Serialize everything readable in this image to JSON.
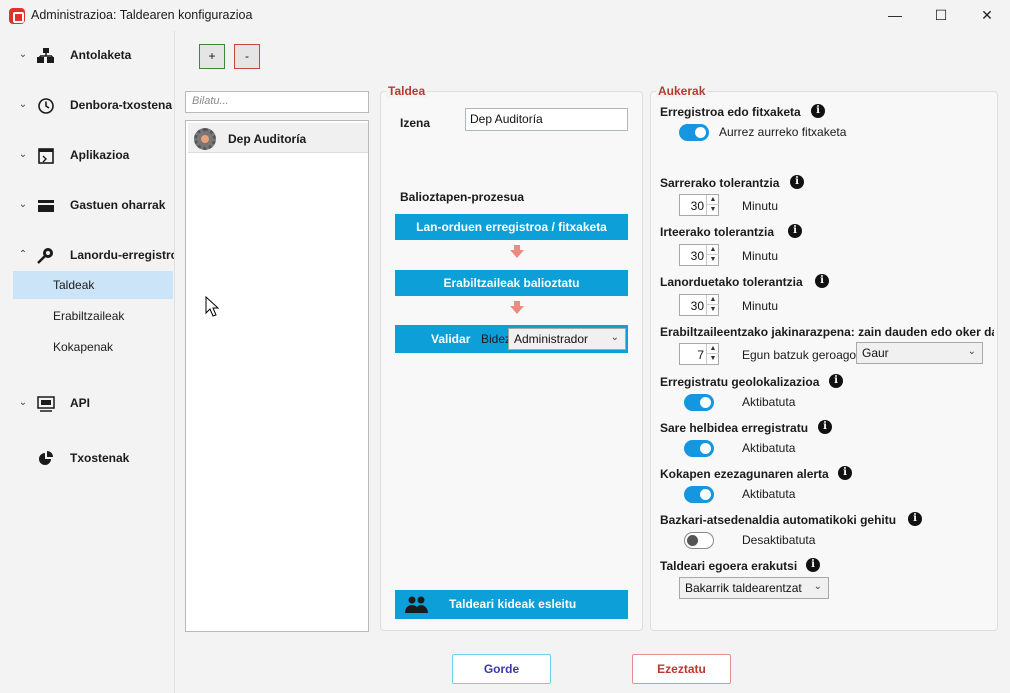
{
  "window": {
    "title": "Administrazioa: Taldearen konfigurazioa",
    "controls": {
      "minimize": "—",
      "maximize": "☐",
      "close": "✕"
    }
  },
  "sidebar": {
    "groups": [
      {
        "label": "Antolaketa",
        "icon": "org-chart-icon",
        "chevron": "⌄"
      },
      {
        "label": "Denbora-txostena",
        "icon": "clock-icon",
        "chevron": "⌄"
      },
      {
        "label": "Aplikazioa",
        "icon": "app-window-icon",
        "chevron": "⌄"
      },
      {
        "label": "Gastuen oharrak",
        "icon": "card-icon",
        "chevron": "⌄"
      },
      {
        "label": "Lanordu-erregistroa",
        "icon": "fingerprint-icon",
        "chevron": "⌃"
      },
      {
        "label": "API",
        "icon": "api-icon",
        "chevron": "⌄"
      },
      {
        "label": "Txostenak",
        "icon": "pie-chart-icon",
        "chevron": ""
      }
    ],
    "subitems": [
      "Taldeak",
      "Erabiltzaileak",
      "Kokapenak"
    ],
    "active_subitem": "Taldeak"
  },
  "toolbar": {
    "add_label": "+",
    "remove_label": "-"
  },
  "search": {
    "placeholder": "Bilatu..."
  },
  "group_list": {
    "items": [
      {
        "label": "Dep Auditoría",
        "icon": "gear-avatar-icon"
      }
    ]
  },
  "taldea": {
    "section_title": "Taldea",
    "name_label": "Izena",
    "name_value": "Dep Auditoría",
    "process_label": "Balioztapen-prozesua",
    "step1": "Lan-orduen erregistroa / fitxaketa",
    "step2": "Erabiltzaileak balioztatu",
    "step3_label": "Validar",
    "step3_bidez": "Bidez",
    "step3_combo": "Administrador",
    "assign_button": "Taldeari kideak esleitu"
  },
  "aukerak": {
    "section_title": "Aukerak",
    "fitxaketa": {
      "label": "Erregistroa edo fitxaketa",
      "toggle_text": "Aurrez aurreko fitxaketa",
      "on": true
    },
    "sarrera": {
      "label": "Sarrerako tolerantzia",
      "value": "30",
      "unit": "Minutu"
    },
    "irteera": {
      "label": "Irteerako tolerantzia",
      "value": "30",
      "unit": "Minutu"
    },
    "lanordu": {
      "label": "Lanorduetako tolerantzia",
      "value": "30",
      "unit": "Minutu"
    },
    "jakinarazpena": {
      "label": "Erabiltzaileentzako jakinarazpena: zain dauden edo oker dau",
      "value": "7",
      "unit": "Egun batzuk geroago",
      "combo": "Gaur"
    },
    "geolok": {
      "label": "Erregistratu geolokalizazioa",
      "state": "Aktibatuta",
      "on": true
    },
    "sare": {
      "label": "Sare helbidea erregistratu",
      "state": "Aktibatuta",
      "on": true
    },
    "kokapen": {
      "label": "Kokapen ezezagunaren alerta",
      "state": "Aktibatuta",
      "on": true
    },
    "bazkari": {
      "label": "Bazkari-atsedenaldia automatikoki gehitu",
      "state": "Desaktibatuta",
      "on": false
    },
    "egoera": {
      "label": "Taldeari egoera erakutsi",
      "combo": "Bakarrik taldearentzat"
    }
  },
  "footer": {
    "save": "Gorde",
    "cancel": "Ezeztatu"
  },
  "colors": {
    "accent_blue": "#0d9fd8",
    "section_red": "#b63c2f",
    "active_bg": "#cce4f7"
  }
}
